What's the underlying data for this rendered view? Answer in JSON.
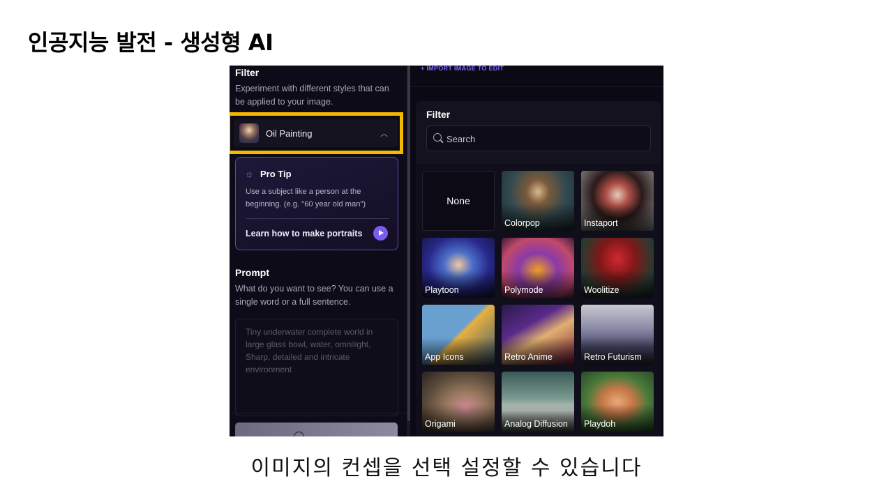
{
  "slide": {
    "title": "인공지능 발전 - 생성형 AI",
    "caption": "이미지의 컨셉을 선택 설정할 수 있습니다"
  },
  "left_panel": {
    "filter_title": "Filter",
    "filter_desc": "Experiment with different styles that can be applied to your image.",
    "selected_filter": "Oil Painting",
    "highlight_color": "#f5b800",
    "pro_tip": {
      "title": "Pro Tip",
      "text": "Use a subject like a person at the beginning. (e.g. \"60 year old man\")",
      "link": "Learn how to make portraits"
    },
    "prompt": {
      "title": "Prompt",
      "desc": "What do you want to see? You can use a single word or a full sentence.",
      "placeholder": "Tiny underwater complete world in large glass bowl, water, omnilight, Sharp, detailed and intricate environment"
    }
  },
  "right_panel": {
    "import_link": "+ IMPORT IMAGE TO EDIT",
    "filter_title": "Filter",
    "search_placeholder": "Search",
    "accent_color": "#7b5cf0",
    "filters": [
      {
        "label": "None"
      },
      {
        "label": "Colorpop"
      },
      {
        "label": "Instaport"
      },
      {
        "label": "Playtoon"
      },
      {
        "label": "Polymode"
      },
      {
        "label": "Woolitize"
      },
      {
        "label": "App Icons"
      },
      {
        "label": "Retro Anime"
      },
      {
        "label": "Retro Futurism"
      },
      {
        "label": "Origami"
      },
      {
        "label": "Analog Diffusion"
      },
      {
        "label": "Playdoh"
      }
    ]
  }
}
